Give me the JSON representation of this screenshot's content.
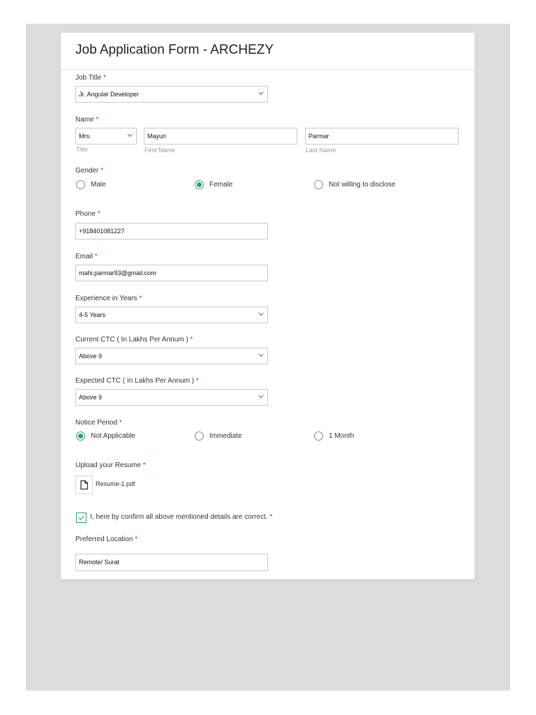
{
  "form": {
    "title": "Job Application Form - ARCHEZY",
    "required_mark": "*",
    "job_title": {
      "label": "Job Title",
      "value": "Jr. Angular Developer"
    },
    "name": {
      "label": "Name",
      "title_value": "Mrs.",
      "title_sub": "Title",
      "first_value": "Mayuri",
      "first_sub": "First Name",
      "last_value": "Parmar",
      "last_sub": "Last Name"
    },
    "gender": {
      "label": "Gender",
      "options": [
        "Male",
        "Female",
        "Not willing to disclose"
      ],
      "selected": "Female"
    },
    "phone": {
      "label": "Phone",
      "value": "+918401081227"
    },
    "email": {
      "label": "Email",
      "value": "mahi.parmar93@gmail.com"
    },
    "experience": {
      "label": "Experience in Years",
      "value": "4-5 Years"
    },
    "current_ctc": {
      "label": "Current CTC ( In Lakhs Per Annum )",
      "value": "Above 9"
    },
    "expected_ctc": {
      "label": "Expected CTC ( In Lakhs Per Annum )",
      "value": "Above 9"
    },
    "notice_period": {
      "label": "Notice Period",
      "options": [
        "Not Applicable",
        "Immediate",
        "1 Month"
      ],
      "selected": "Not Applicable"
    },
    "resume": {
      "label": "Upload your Resume",
      "file_name": "Resume-1.pdf"
    },
    "confirm": {
      "label": "I, here by confirm all above mentioned details are correct.",
      "checked": true
    },
    "location": {
      "label": "Preferred Location",
      "value": "Remote/ Surat"
    }
  },
  "colors": {
    "accent": "#2e9e6e",
    "required": "#e02020",
    "background": "#dcdcdc"
  },
  "icons": {
    "select_arrow": "chevron-down-icon",
    "file": "file-icon",
    "check": "check-icon"
  }
}
